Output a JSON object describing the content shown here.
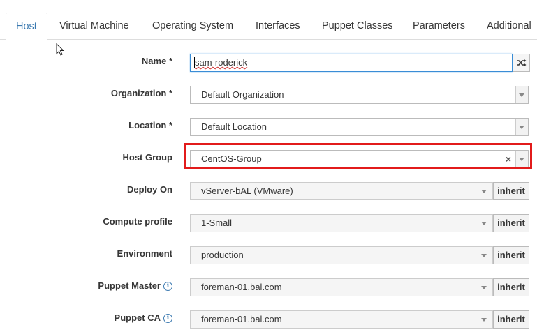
{
  "tabs": [
    "Host",
    "Virtual Machine",
    "Operating System",
    "Interfaces",
    "Puppet Classes",
    "Parameters",
    "Additional"
  ],
  "form": {
    "name": {
      "label": "Name *",
      "value": "sam-roderick",
      "value_first": "s",
      "value_rest": "am-roderick"
    },
    "organization": {
      "label": "Organization *",
      "value": "Default Organization"
    },
    "location": {
      "label": "Location *",
      "value": "Default Location"
    },
    "host_group": {
      "label": "Host Group",
      "value": "CentOS-Group",
      "clear": "×"
    },
    "deploy_on": {
      "label": "Deploy On",
      "value": "vServer-bAL (VMware)",
      "button": "inherit"
    },
    "compute_profile": {
      "label": "Compute profile",
      "value": "1-Small",
      "button": "inherit"
    },
    "environment": {
      "label": "Environment",
      "value": "production",
      "button": "inherit"
    },
    "puppet_master": {
      "label": "Puppet Master",
      "value": "foreman-01.bal.com",
      "button": "inherit",
      "info": "i"
    },
    "puppet_ca": {
      "label": "Puppet CA",
      "value": "foreman-01.bal.com",
      "button": "inherit",
      "info": "i"
    }
  },
  "colors": {
    "accent": "#3a79b0",
    "highlight": "#e21b1b",
    "focus": "#3a8dd6"
  },
  "icons": {
    "shuffle": "shuffle-icon",
    "cursor": "mouse-pointer-icon",
    "info": "info-icon",
    "dropdown": "chevron-down-icon"
  }
}
